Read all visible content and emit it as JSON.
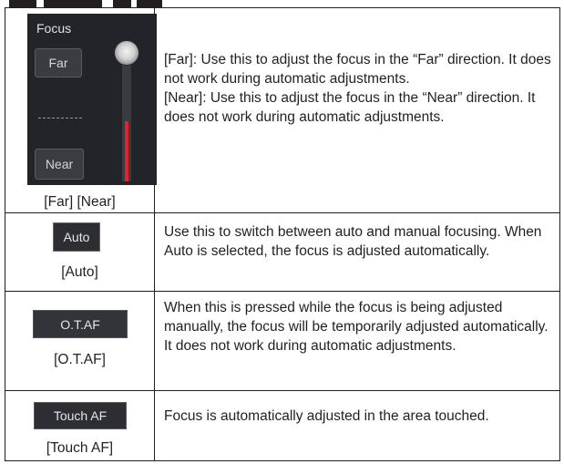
{
  "focus_panel": {
    "title": "Focus",
    "far_label": "Far",
    "near_label": "Near",
    "divider_text": "--------",
    "slider_level": 0.45,
    "colors": {
      "panel_bg": "#232429",
      "slider_fill": "#e3222a"
    }
  },
  "rows": [
    {
      "caption": "[Far] [Near]",
      "description": "[Far]: Use this to adjust the focus in the “Far” direction. It does not work during automatic adjustments.\n[Near]: Use this to adjust the focus in the “Near” direction. It does not work during automatic adjustments."
    },
    {
      "button_label": "Auto",
      "caption": "[Auto]",
      "description": "Use this to switch between auto and manual focusing. When Auto is selected, the focus is adjusted automatically."
    },
    {
      "button_label": "O.T.AF",
      "caption": "[O.T.AF]",
      "description": "When this is pressed while the focus is being adjusted manually, the focus will be temporarily adjusted automatically.\nIt does not work during automatic adjustments."
    },
    {
      "button_label": "Touch AF",
      "caption": "[Touch AF]",
      "description": "Focus is automatically adjusted in the area touched."
    }
  ]
}
